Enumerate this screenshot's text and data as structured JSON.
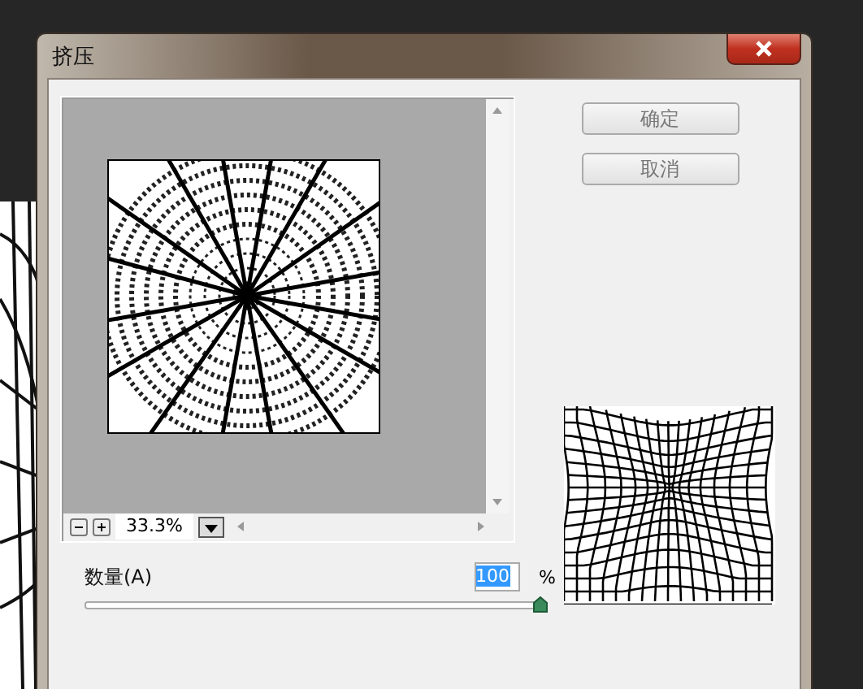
{
  "window": {
    "title": "挤压"
  },
  "preview": {
    "zoom": "33.3%"
  },
  "buttons": [
    {
      "label": "确定"
    },
    {
      "label": "取消"
    }
  ],
  "amount": {
    "label": "数量(A)",
    "value": "100",
    "unit": "%",
    "level": 1
  }
}
